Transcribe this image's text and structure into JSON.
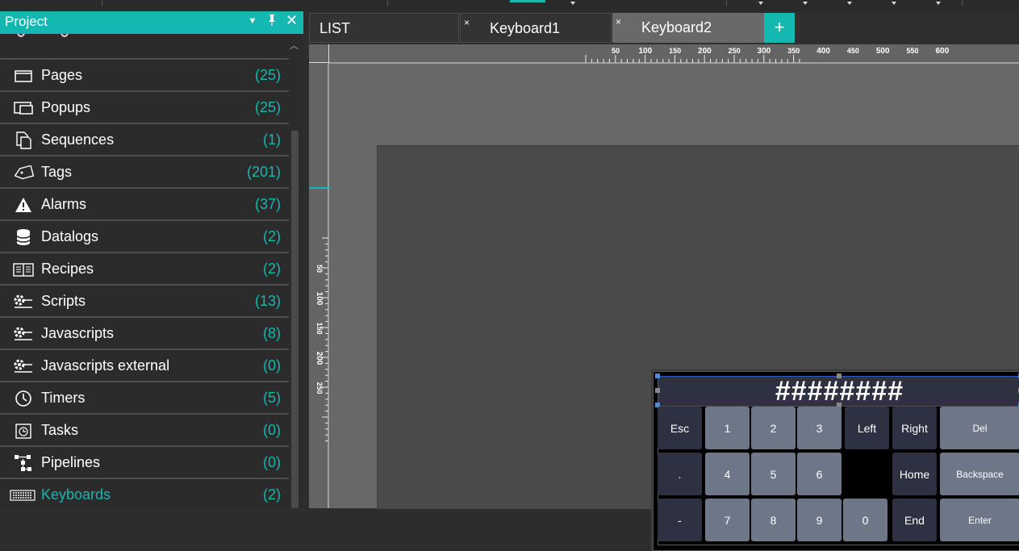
{
  "project_panel": {
    "title": "Project",
    "items": [
      {
        "label": "Pages",
        "count": "(25)",
        "icon": "page-icon"
      },
      {
        "label": "Popups",
        "count": "(25)",
        "icon": "popup-icon"
      },
      {
        "label": "Sequences",
        "count": "(1)",
        "icon": "sequences-icon"
      },
      {
        "label": "Tags",
        "count": "(201)",
        "icon": "tag-icon"
      },
      {
        "label": "Alarms",
        "count": "(37)",
        "icon": "alarm-icon"
      },
      {
        "label": "Datalogs",
        "count": "(2)",
        "icon": "database-icon"
      },
      {
        "label": "Recipes",
        "count": "(2)",
        "icon": "recipe-book-icon"
      },
      {
        "label": "Scripts",
        "count": "(13)",
        "icon": "script-gear-icon"
      },
      {
        "label": "Javascripts",
        "count": "(8)",
        "icon": "javascript-gear-icon"
      },
      {
        "label": "Javascripts external",
        "count": "(0)",
        "icon": "javascript-external-gear-icon"
      },
      {
        "label": "Timers",
        "count": "(5)",
        "icon": "clock-icon"
      },
      {
        "label": "Tasks",
        "count": "(0)",
        "icon": "task-icon"
      },
      {
        "label": "Pipelines",
        "count": "(0)",
        "icon": "pipeline-icon"
      },
      {
        "label": "Keyboards",
        "count": "(2)",
        "icon": "keyboard-icon",
        "active": true
      }
    ]
  },
  "tabs": [
    {
      "label": "LIST",
      "close": ""
    },
    {
      "label": "Keyboard1",
      "close": "×"
    },
    {
      "label": "Keyboard2",
      "close": "×",
      "active": true
    }
  ],
  "add_tab_label": "+",
  "ruler": {
    "horizontal_ticks": [
      "50",
      "100",
      "150",
      "200",
      "250",
      "300",
      "350",
      "400",
      "450",
      "500",
      "550",
      "600"
    ],
    "vertical_ticks": [
      "50",
      "100",
      "150",
      "200",
      "250"
    ]
  },
  "keyboard": {
    "display_text": "########",
    "keys": {
      "esc": "Esc",
      "k1": "1",
      "k2": "2",
      "k3": "3",
      "left": "Left",
      "right": "Right",
      "del": "Del",
      "dot": ".",
      "k4": "4",
      "k5": "5",
      "k6": "6",
      "home": "Home",
      "backspace": "Backspace",
      "minus": "-",
      "k7": "7",
      "k8": "8",
      "k9": "9",
      "k0": "0",
      "end": "End",
      "enter": "Enter"
    }
  },
  "colors": {
    "accent": "#14b8b0",
    "key_dark": "#2d3142",
    "key_light": "#6e7788"
  }
}
